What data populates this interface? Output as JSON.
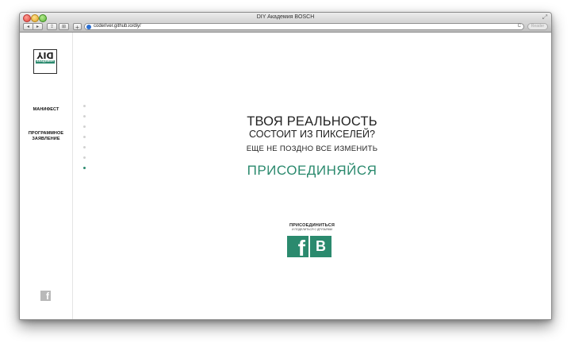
{
  "window": {
    "title": "DIY Академия BOSCH"
  },
  "toolbar": {
    "back_icon": "◂",
    "forward_icon": "▸",
    "share_icon": "⇪",
    "tabs_icon": "⊞",
    "add_icon": "+",
    "url": "coderiver.github.io/diy/",
    "reload_icon": "C",
    "reader_label": "Reader"
  },
  "logo": {
    "letters_top": "DIY",
    "stripe_text": "АКАДЕМИЯ",
    "letters_bottom": ""
  },
  "sidebar": {
    "items": [
      {
        "label": "МАНИФЕСТ"
      },
      {
        "label": "ПРОГРАММНОЕ ЗАЯВЛЕНИЕ"
      }
    ],
    "facebook_icon": "f"
  },
  "pager": {
    "count": 7,
    "active_index": 6
  },
  "hero": {
    "line1": "ТВОЯ РЕАЛЬНОСТЬ",
    "line2": "СОСТОИТ ИЗ ПИКСЕЛЕЙ?",
    "line3": "ЕЩЕ НЕ ПОЗДНО ВСЕ ИЗМЕНИТЬ",
    "cta": "ПРИСОЕДИНЯЙСЯ"
  },
  "share": {
    "title": "ПРИСОЕДИНИТЬСЯ",
    "subtitle": "И ПОДЕЛИТЬСЯ С ДРУЗЬЯМИ",
    "facebook_glyph": "f",
    "vk_glyph": "В"
  },
  "colors": {
    "accent": "#2b8a6e",
    "text": "#222222",
    "dot_inactive": "#d2d2d2"
  }
}
